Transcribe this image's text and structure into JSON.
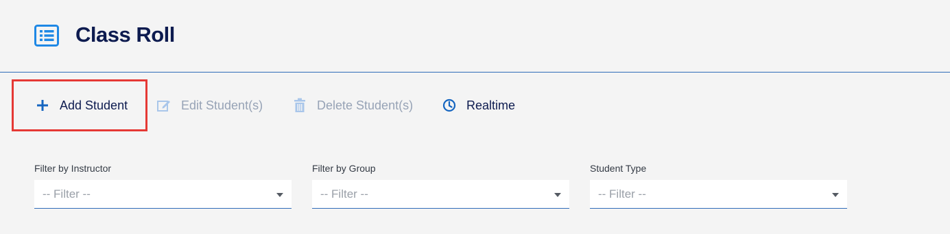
{
  "header": {
    "title": "Class Roll",
    "icon": "list-icon",
    "accent_color": "#1e88e5"
  },
  "toolbar": {
    "add_label": "Add Student",
    "edit_label": "Edit Student(s)",
    "delete_label": "Delete Student(s)",
    "realtime_label": "Realtime",
    "highlight_color": "#e53935",
    "disabled_color": "#97a3b6"
  },
  "filters": [
    {
      "label": "Filter by Instructor",
      "value": "-- Filter --"
    },
    {
      "label": "Filter by Group",
      "value": "-- Filter --"
    },
    {
      "label": "Student Type",
      "value": "-- Filter --"
    }
  ]
}
